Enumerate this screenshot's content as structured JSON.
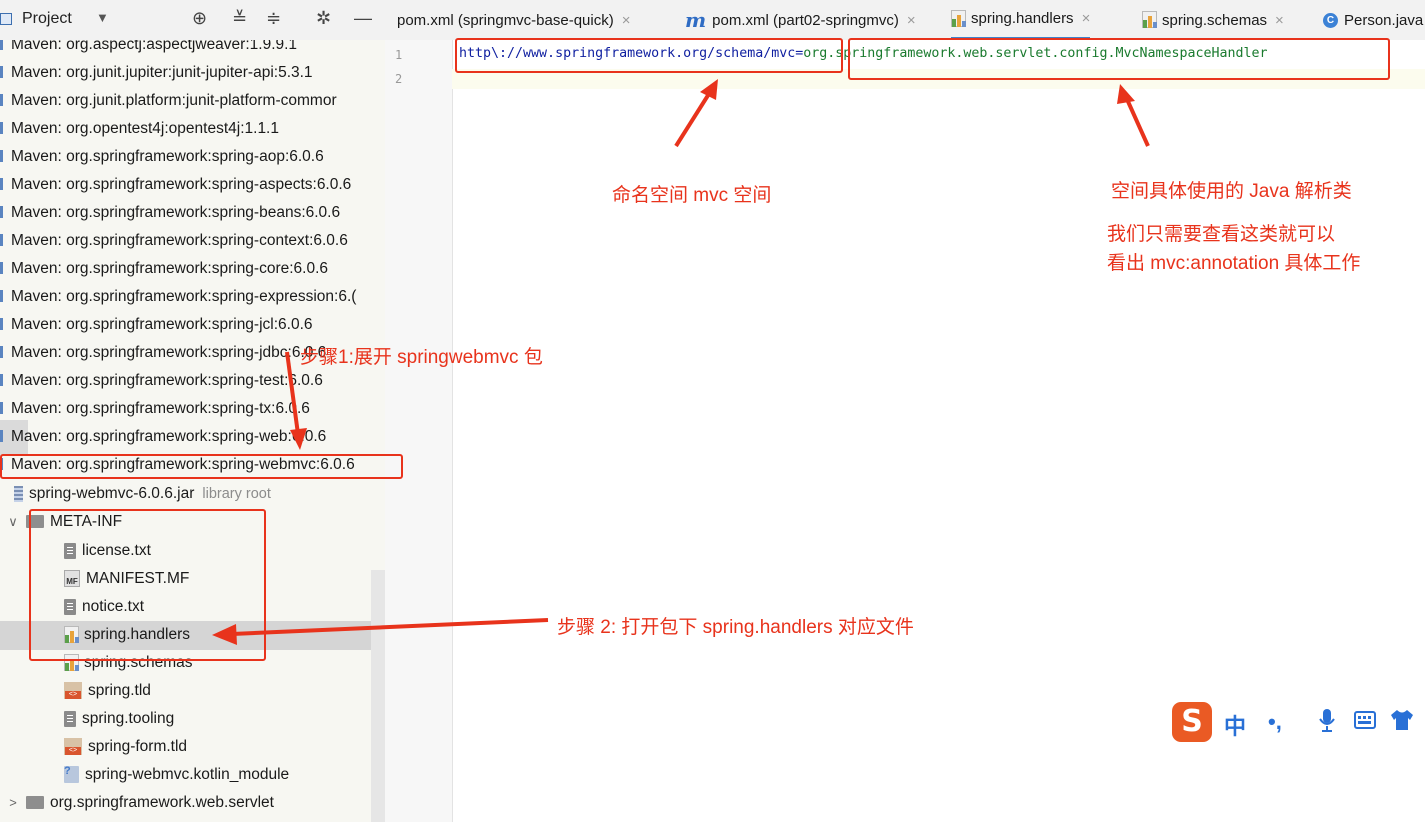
{
  "project_header": {
    "title": "Project",
    "caret": "▼"
  },
  "toolbar_icons": [
    "target-icon",
    "expand-all-icon",
    "collapse-all-icon",
    "gear-icon",
    "minimize-icon"
  ],
  "tabs": [
    {
      "label": "pom.xml (springmvc-base-quick)",
      "icon": "none",
      "close": "×"
    },
    {
      "label": "pom.xml (part02-springmvc)",
      "icon": "maven-m",
      "close": "×"
    },
    {
      "label": "spring.handlers",
      "icon": "properties-file",
      "close": "×",
      "active": true
    },
    {
      "label": "spring.schemas",
      "icon": "properties-file",
      "close": "×"
    },
    {
      "label": "Person.java",
      "icon": "class-c"
    }
  ],
  "sidebar": {
    "libraries": [
      "Maven: org.aspectj:aspectjweaver:1.9.9.1",
      "Maven: org.junit.jupiter:junit-jupiter-api:5.3.1",
      "Maven: org.junit.platform:junit-platform-commor",
      "Maven: org.opentest4j:opentest4j:1.1.1",
      "Maven: org.springframework:spring-aop:6.0.6",
      "Maven: org.springframework:spring-aspects:6.0.6",
      "Maven: org.springframework:spring-beans:6.0.6",
      "Maven: org.springframework:spring-context:6.0.6",
      "Maven: org.springframework:spring-core:6.0.6",
      "Maven: org.springframework:spring-expression:6.(",
      "Maven: org.springframework:spring-jcl:6.0.6",
      "Maven: org.springframework:spring-jdbc:6.0.6",
      "Maven: org.springframework:spring-test:6.0.6",
      "Maven: org.springframework:spring-tx:6.0.6",
      "Maven: org.springframework:spring-web:6.0.6",
      "Maven: org.springframework:spring-webmvc:6.0.6"
    ],
    "jar": {
      "name": "spring-webmvc-6.0.6.jar",
      "suffix": "library root"
    },
    "meta_inf": {
      "name": "META-INF",
      "chevron": "∨"
    },
    "files": [
      {
        "name": "license.txt",
        "icon": "text"
      },
      {
        "name": "MANIFEST.MF",
        "icon": "manifest"
      },
      {
        "name": "notice.txt",
        "icon": "text"
      },
      {
        "name": "spring.handlers",
        "icon": "properties",
        "selected": true
      },
      {
        "name": "spring.schemas",
        "icon": "properties"
      },
      {
        "name": "spring.tld",
        "icon": "tld"
      },
      {
        "name": "spring.tooling",
        "icon": "text"
      },
      {
        "name": "spring-form.tld",
        "icon": "tld"
      },
      {
        "name": "spring-webmvc.kotlin_module",
        "icon": "kotlin-module"
      }
    ],
    "package": {
      "name": "org.springframework.web.servlet",
      "chevron": ">"
    }
  },
  "editor": {
    "line_numbers": [
      "1",
      "2"
    ],
    "line1_key": "http\\://www.springframework.org/schema/mvc",
    "line1_eq": "=",
    "line1_value": "org.springframework.web.servlet.config.MvcNamespaceHandler"
  },
  "annotations": {
    "namespace": "命名空间 mvc 空间",
    "parser_class": "空间具体使用的 Java 解析类",
    "note_line1": "我们只需要查看这类就可以",
    "note_line2": "看出 mvc:annotation 具体工作",
    "step1": "步骤1:展开 springwebmvc 包",
    "step2": "步骤 2: 打开包下 spring.handlers 对应文件"
  },
  "ime_toolbar": {
    "logo": "S",
    "mode": "中",
    "punct": "•,",
    "icons": [
      "microphone-icon",
      "keyboard-icon",
      "shirt-icon"
    ]
  },
  "colors": {
    "annotation_red": "#e8331c",
    "active_tab_underline": "#4083c9",
    "key_blue": "#0f1fa0",
    "value_green": "#1a7a2e"
  }
}
